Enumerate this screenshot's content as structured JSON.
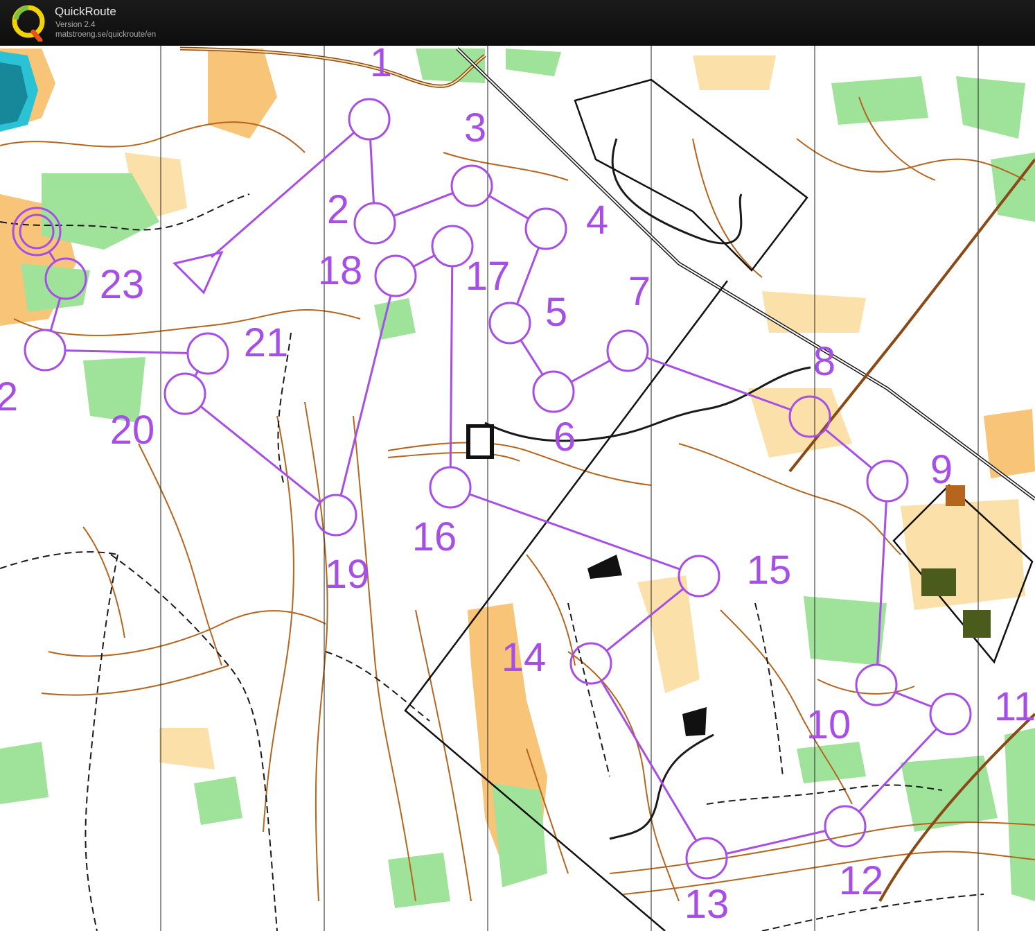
{
  "header": {
    "app_name": "QuickRoute",
    "version": "Version 2.4",
    "url": "matstroeng.se/quickroute/en",
    "logo_letter": "Q"
  },
  "course": {
    "color": "#a64ee6",
    "start_label": "",
    "controls": [
      {
        "label": "1"
      },
      {
        "label": "2"
      },
      {
        "label": "3"
      },
      {
        "label": "4"
      },
      {
        "label": "5"
      },
      {
        "label": "6"
      },
      {
        "label": "7"
      },
      {
        "label": "8"
      },
      {
        "label": "9"
      },
      {
        "label": "10"
      },
      {
        "label": "11"
      },
      {
        "label": "12"
      },
      {
        "label": "13"
      },
      {
        "label": "14"
      },
      {
        "label": "15"
      },
      {
        "label": "16"
      },
      {
        "label": "17"
      },
      {
        "label": "18"
      },
      {
        "label": "19"
      },
      {
        "label": "20"
      },
      {
        "label": "21"
      },
      {
        "label": "2"
      },
      {
        "label": "23"
      }
    ],
    "finish_label": ""
  },
  "map_colors": {
    "contour": "#b5651d",
    "open_land": "#f8c477",
    "rough_open": "#fbe1a9",
    "green_vegetation": "#9fe39a",
    "water": "#2bc2d6",
    "paths": "#1a1a1a"
  }
}
